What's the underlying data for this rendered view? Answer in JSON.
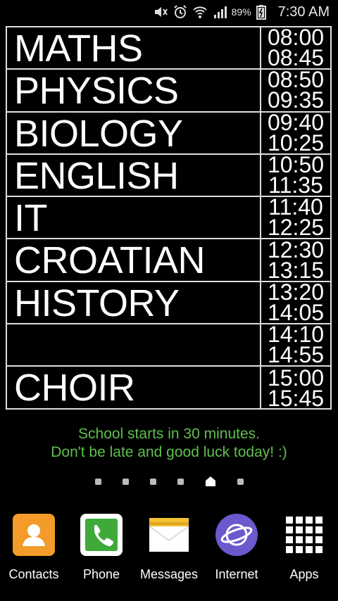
{
  "status_bar": {
    "icons": [
      "mute-icon",
      "alarm-icon",
      "wifi-icon",
      "signal-icon",
      "battery-icon"
    ],
    "battery": "89%",
    "time": "7:30 AM"
  },
  "timetable": [
    {
      "subject": "MATHS",
      "start": "08:00",
      "end": "08:45"
    },
    {
      "subject": "PHYSICS",
      "start": "08:50",
      "end": "09:35"
    },
    {
      "subject": "BIOLOGY",
      "start": "09:40",
      "end": "10:25"
    },
    {
      "subject": "ENGLISH",
      "start": "10:50",
      "end": "11:35"
    },
    {
      "subject": "IT",
      "start": "11:40",
      "end": "12:25"
    },
    {
      "subject": "CROATIAN",
      "start": "12:30",
      "end": "13:15"
    },
    {
      "subject": "HISTORY",
      "start": "13:20",
      "end": "14:05"
    },
    {
      "subject": "",
      "start": "14:10",
      "end": "14:55"
    },
    {
      "subject": "CHOIR",
      "start": "15:00",
      "end": "15:45"
    }
  ],
  "message": {
    "line1": "School starts in 30 minutes.",
    "line2": "Don't be late and good luck today! :)"
  },
  "page_indicator": {
    "count": 6,
    "current": 5,
    "current_icon": "home-icon"
  },
  "dock": [
    {
      "label": "Contacts",
      "icon": "contacts-icon"
    },
    {
      "label": "Phone",
      "icon": "phone-icon"
    },
    {
      "label": "Messages",
      "icon": "messages-icon"
    },
    {
      "label": "Internet",
      "icon": "internet-icon"
    },
    {
      "label": "Apps",
      "icon": "apps-grid-icon"
    }
  ],
  "colors": {
    "message": "#5fbf4f",
    "contacts": "#f39c2a",
    "phone": "#3faa3a",
    "messages": "#f2c230",
    "internet": "#6a5acd"
  }
}
